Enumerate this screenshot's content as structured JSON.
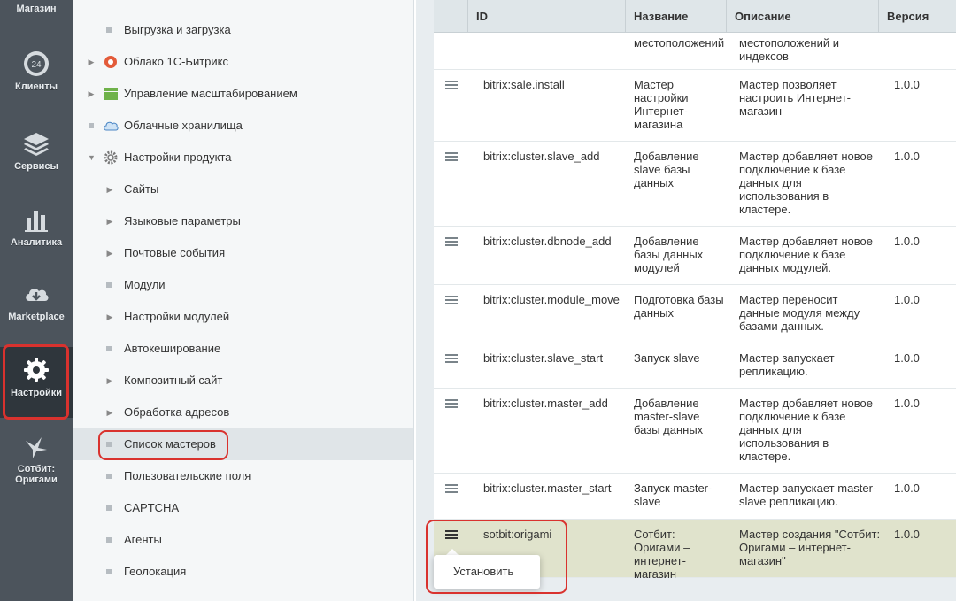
{
  "rail": {
    "items": [
      {
        "label": "Магазин",
        "icon": "shop-icon"
      },
      {
        "label": "Клиенты",
        "icon": "clients-24-icon",
        "badge": "24"
      },
      {
        "label": "Сервисы",
        "icon": "layers-icon"
      },
      {
        "label": "Аналитика",
        "icon": "bar-chart-icon"
      },
      {
        "label": "Marketplace",
        "icon": "cloud-download-icon"
      },
      {
        "label": "Настройки",
        "icon": "gear-icon"
      },
      {
        "label": "Сотбит: Оригами",
        "icon": "crane-icon"
      }
    ]
  },
  "tree": {
    "items": [
      {
        "label": "Выгрузка и загрузка"
      },
      {
        "label": "Облако 1С-Битрикс"
      },
      {
        "label": "Управление масштабированием"
      },
      {
        "label": "Облачные хранилища"
      },
      {
        "label": "Настройки продукта"
      },
      {
        "label": "Сайты"
      },
      {
        "label": "Языковые параметры"
      },
      {
        "label": "Почтовые события"
      },
      {
        "label": "Модули"
      },
      {
        "label": "Настройки модулей"
      },
      {
        "label": "Автокеширование"
      },
      {
        "label": "Композитный сайт"
      },
      {
        "label": "Обработка адресов"
      },
      {
        "label": "Список мастеров"
      },
      {
        "label": "Пользовательские поля"
      },
      {
        "label": "CAPTCHA"
      },
      {
        "label": "Агенты"
      },
      {
        "label": "Геолокация"
      }
    ]
  },
  "table": {
    "headers": {
      "id": "ID",
      "name": "Название",
      "description": "Описание",
      "version": "Версия"
    },
    "rows": [
      {
        "id": "",
        "name": "местоположений",
        "description": "местоположений и индексов",
        "version": ""
      },
      {
        "id": "bitrix:sale.install",
        "name": "Мастер настройки Интернет-магазина",
        "description": "Мастер позволяет настроить Интернет-магазин",
        "version": "1.0.0"
      },
      {
        "id": "bitrix:cluster.slave_add",
        "name": "Добавление slave базы данных",
        "description": "Мастер добавляет новое подключение к базе данных для использования в кластере.",
        "version": "1.0.0"
      },
      {
        "id": "bitrix:cluster.dbnode_add",
        "name": "Добавление базы данных модулей",
        "description": "Мастер добавляет новое подключение к базе данных модулей.",
        "version": "1.0.0"
      },
      {
        "id": "bitrix:cluster.module_move",
        "name": "Подготовка базы данных",
        "description": "Мастер переносит данные модуля между базами данных.",
        "version": "1.0.0"
      },
      {
        "id": "bitrix:cluster.slave_start",
        "name": "Запуск slave",
        "description": "Мастер запускает репликацию.",
        "version": "1.0.0"
      },
      {
        "id": "bitrix:cluster.master_add",
        "name": "Добавление master-slave базы данных",
        "description": "Мастер добавляет новое подключение к базе данных для использования в кластере.",
        "version": "1.0.0"
      },
      {
        "id": "bitrix:cluster.master_start",
        "name": "Запуск master-slave",
        "description": "Мастер запускает master-slave репликацию.",
        "version": "1.0.0"
      },
      {
        "id": "sotbit:origami",
        "name": "Сотбит: Оригами – интернет-магазин",
        "description": "Мастер создания \"Сотбит: Оригами – интернет-магазин\"",
        "version": "1.0.0"
      }
    ],
    "popup_label": "Установить"
  },
  "colors": {
    "rail_bg": "#4c545c",
    "highlight_red": "#d9322e",
    "selected_row": "#e0e3cc"
  }
}
